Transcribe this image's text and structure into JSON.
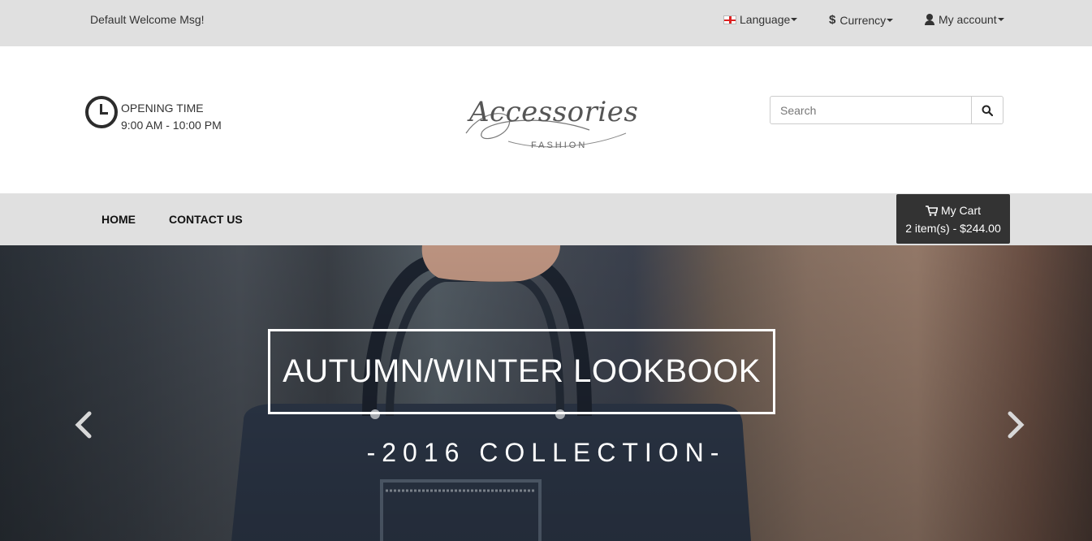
{
  "topbar": {
    "welcome": "Default Welcome Msg!",
    "language_label": "Language",
    "currency_label": "Currency",
    "account_label": "My account"
  },
  "header": {
    "opening_title": "OPENING TIME",
    "opening_hours": "9:00 AM - 10:00 PM",
    "logo_script": "Accessories",
    "logo_sub": "FASHION",
    "search_placeholder": "Search"
  },
  "nav": {
    "items": [
      {
        "label": "HOME"
      },
      {
        "label": "CONTACT US"
      }
    ]
  },
  "cart": {
    "label": "My Cart",
    "summary": "2 item(s) - $244.00"
  },
  "hero": {
    "title": "AUTUMN/WINTER LOOKBOOK",
    "subtitle": "-2016 COLLECTION-"
  },
  "colors": {
    "topbar_bg": "#e0e0e0",
    "cart_bg": "#333333",
    "text": "#333333"
  },
  "icons": [
    "flag-icon",
    "dollar-icon",
    "user-icon",
    "clock-icon",
    "search-icon",
    "cart-icon",
    "chevron-left-icon",
    "chevron-right-icon"
  ]
}
